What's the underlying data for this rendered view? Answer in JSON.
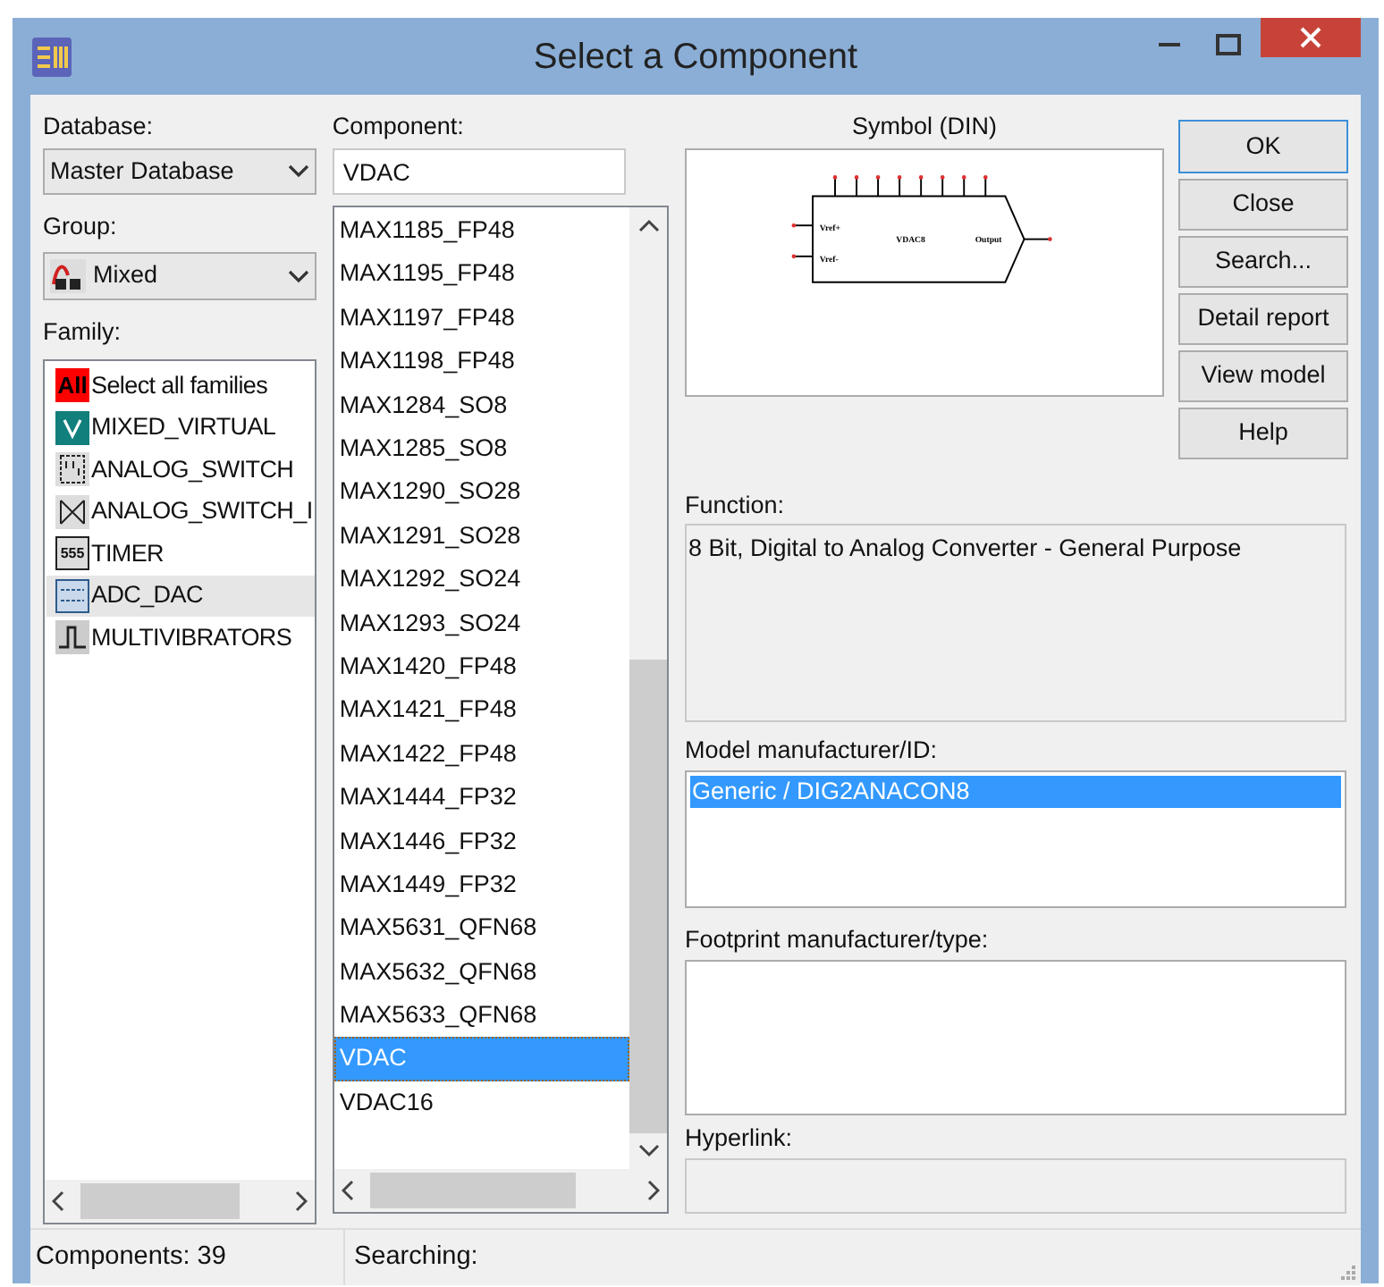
{
  "window": {
    "title": "Select a Component"
  },
  "database": {
    "label": "Database:",
    "value": "Master Database"
  },
  "group": {
    "label": "Group:",
    "value": "Mixed"
  },
  "family": {
    "label": "Family:",
    "items": [
      {
        "label": "Select all families",
        "kind": "all",
        "badge": "All",
        "selected": false
      },
      {
        "label": "MIXED_VIRTUAL",
        "kind": "virtual",
        "selected": false
      },
      {
        "label": "ANALOG_SWITCH",
        "kind": "switch",
        "selected": false
      },
      {
        "label": "ANALOG_SWITCH_I",
        "kind": "switch2",
        "selected": false
      },
      {
        "label": "TIMER",
        "kind": "timer",
        "badge": "555",
        "selected": false
      },
      {
        "label": "ADC_DAC",
        "kind": "adc",
        "selected": true
      },
      {
        "label": "MULTIVIBRATORS",
        "kind": "pulse",
        "selected": false
      }
    ]
  },
  "component": {
    "label": "Component:",
    "value": "VDAC",
    "items": [
      {
        "label": "MAX1185_FP48",
        "selected": false
      },
      {
        "label": "MAX1195_FP48",
        "selected": false
      },
      {
        "label": "MAX1197_FP48",
        "selected": false
      },
      {
        "label": "MAX1198_FP48",
        "selected": false
      },
      {
        "label": "MAX1284_SO8",
        "selected": false
      },
      {
        "label": "MAX1285_SO8",
        "selected": false
      },
      {
        "label": "MAX1290_SO28",
        "selected": false
      },
      {
        "label": "MAX1291_SO28",
        "selected": false
      },
      {
        "label": "MAX1292_SO24",
        "selected": false
      },
      {
        "label": "MAX1293_SO24",
        "selected": false
      },
      {
        "label": "MAX1420_FP48",
        "selected": false
      },
      {
        "label": "MAX1421_FP48",
        "selected": false
      },
      {
        "label": "MAX1422_FP48",
        "selected": false
      },
      {
        "label": "MAX1444_FP32",
        "selected": false
      },
      {
        "label": "MAX1446_FP32",
        "selected": false
      },
      {
        "label": "MAX1449_FP32",
        "selected": false
      },
      {
        "label": "MAX5631_QFN68",
        "selected": false
      },
      {
        "label": "MAX5632_QFN68",
        "selected": false
      },
      {
        "label": "MAX5633_QFN68",
        "selected": false
      },
      {
        "label": "VDAC",
        "selected": true
      },
      {
        "label": "VDAC16",
        "selected": false
      }
    ]
  },
  "symbol": {
    "title": "Symbol (DIN)",
    "inputs": [
      "Vref+",
      "Vref-"
    ],
    "name": "VDAC8",
    "output": "Output"
  },
  "buttons": [
    {
      "label": "OK",
      "focused": true
    },
    {
      "label": "Close",
      "focused": false
    },
    {
      "label": "Search...",
      "focused": false
    },
    {
      "label": "Detail report",
      "focused": false
    },
    {
      "label": "View model",
      "focused": false
    },
    {
      "label": "Help",
      "focused": false
    }
  ],
  "function": {
    "label": "Function:",
    "value": "8 Bit, Digital to Analog Converter - General Purpose"
  },
  "model": {
    "label": "Model manufacturer/ID:",
    "items": [
      {
        "label": "Generic / DIG2ANACON8",
        "selected": true
      }
    ]
  },
  "footprint": {
    "label": "Footprint manufacturer/type:"
  },
  "hyperlink": {
    "label": "Hyperlink:"
  },
  "status_bar": {
    "components": "Components: 39",
    "searching": "Searching:"
  }
}
